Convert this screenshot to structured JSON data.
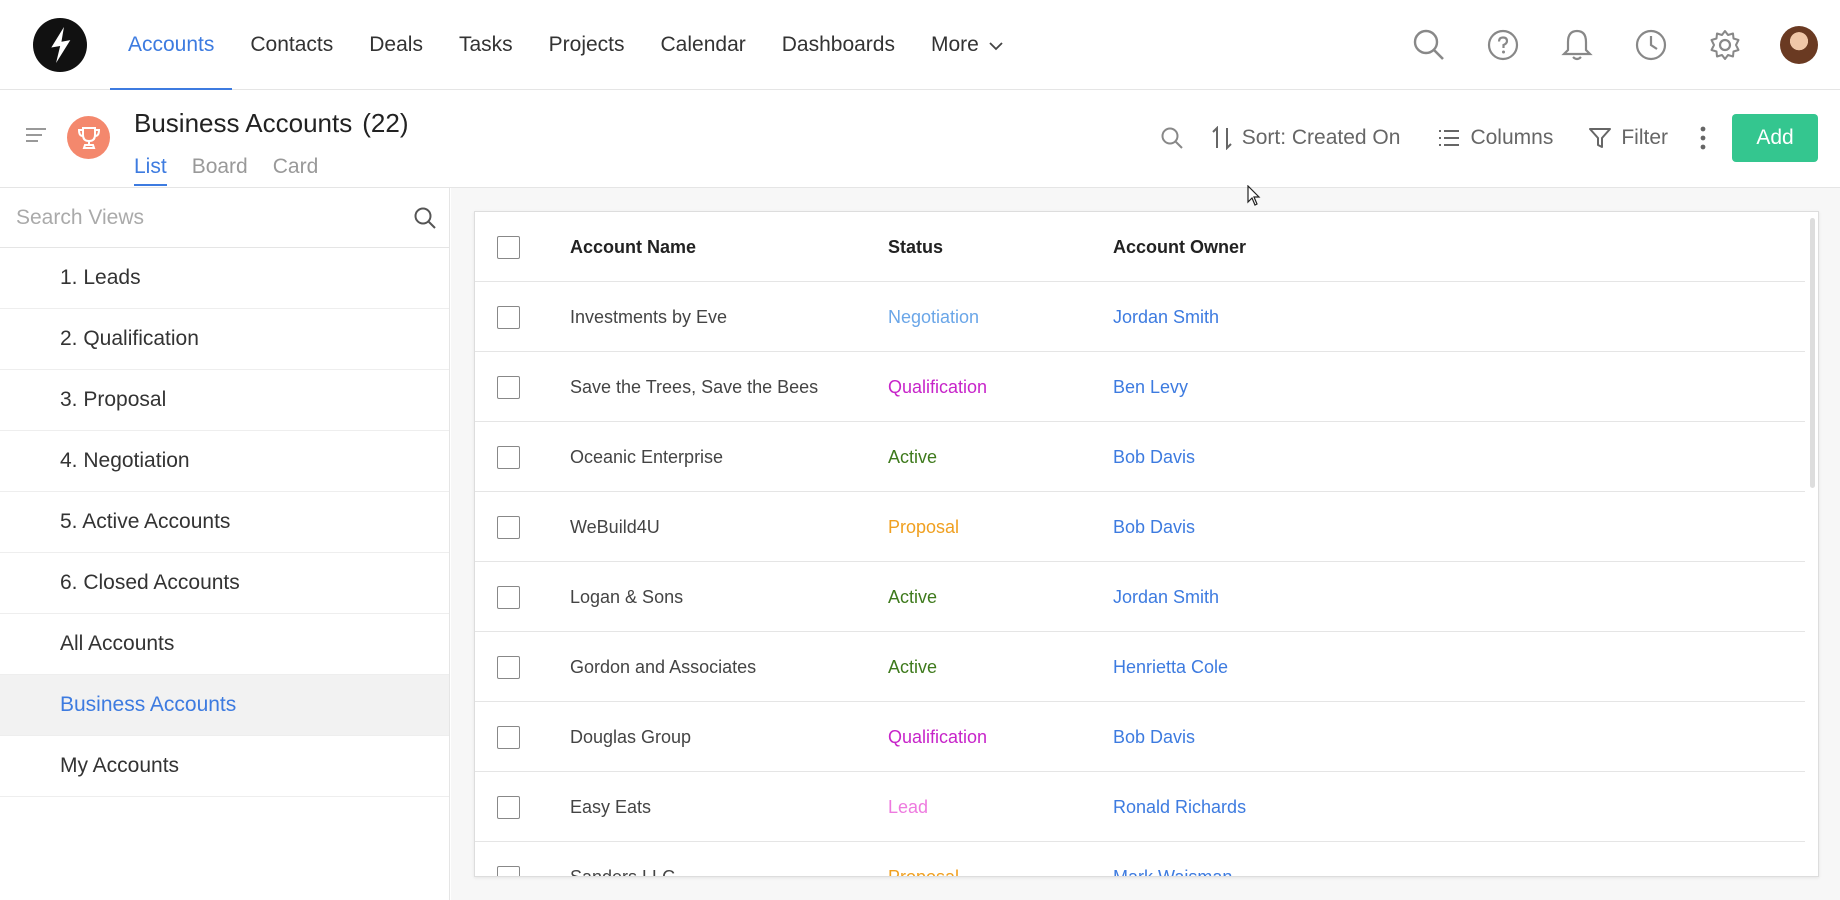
{
  "nav": {
    "items": [
      "Accounts",
      "Contacts",
      "Deals",
      "Tasks",
      "Projects",
      "Calendar",
      "Dashboards",
      "More"
    ],
    "active": "Accounts"
  },
  "top_icons": [
    "search-icon",
    "help-icon",
    "bell-icon",
    "clock-icon",
    "gear-icon",
    "avatar"
  ],
  "header": {
    "title": "Business Accounts",
    "count": "(22)",
    "view_tabs": [
      "List",
      "Board",
      "Card"
    ],
    "active_tab": "List"
  },
  "toolbar": {
    "sort_label": "Sort: Created On",
    "columns_label": "Columns",
    "filter_label": "Filter",
    "add_label": "Add"
  },
  "sidebar": {
    "search_placeholder": "Search Views",
    "items": [
      "1. Leads",
      "2. Qualification",
      "3. Proposal",
      "4. Negotiation",
      "5. Active Accounts",
      "6. Closed Accounts",
      "All Accounts",
      "Business Accounts",
      "My Accounts"
    ],
    "selected": "Business Accounts"
  },
  "table": {
    "columns": [
      "Account Name",
      "Status",
      "Account Owner"
    ],
    "rows": [
      {
        "name": "Investments by Eve",
        "status": "Negotiation",
        "owner": "Jordan Smith"
      },
      {
        "name": "Save the Trees, Save the Bees",
        "status": "Qualification",
        "owner": "Ben Levy"
      },
      {
        "name": "Oceanic Enterprise",
        "status": "Active",
        "owner": "Bob Davis"
      },
      {
        "name": "WeBuild4U",
        "status": "Proposal",
        "owner": "Bob Davis"
      },
      {
        "name": "Logan & Sons",
        "status": "Active",
        "owner": "Jordan Smith"
      },
      {
        "name": "Gordon and Associates",
        "status": "Active",
        "owner": "Henrietta Cole"
      },
      {
        "name": "Douglas Group",
        "status": "Qualification",
        "owner": "Bob Davis"
      },
      {
        "name": "Easy Eats",
        "status": "Lead",
        "owner": "Ronald Richards"
      },
      {
        "name": "Sanders LLC",
        "status": "Proposal",
        "owner": "Mark Waisman"
      }
    ]
  },
  "status_colors": {
    "Negotiation": "#6aa6e8",
    "Qualification": "#c724c9",
    "Active": "#3e7a1c",
    "Proposal": "#f0a020",
    "Lead": "#ee7adf"
  },
  "colors": {
    "accent": "#3d7be0",
    "add_button": "#34c68f",
    "trophy_badge": "#f4886d"
  }
}
